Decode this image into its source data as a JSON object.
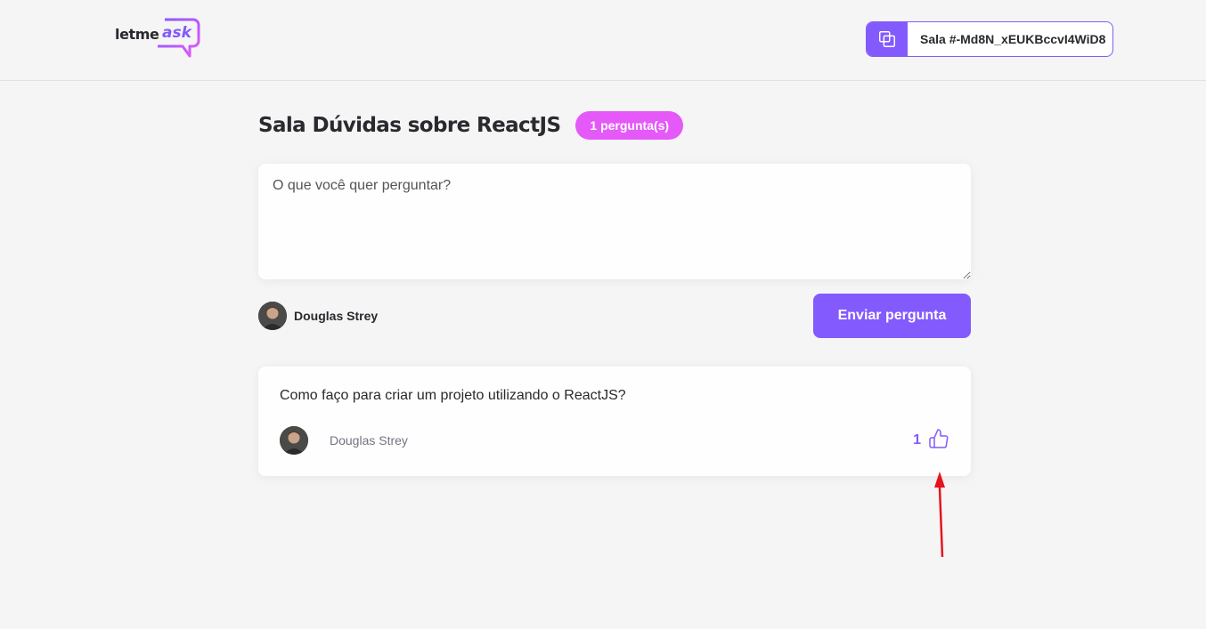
{
  "header": {
    "logo": {
      "prefix": "letme",
      "accent": "ask"
    },
    "room_code": {
      "label": "Sala #-Md8N_xEUKBccvI4WiD8",
      "icon": "copy-icon"
    }
  },
  "room": {
    "title": "Sala Dúvidas sobre ReactJS",
    "question_count_label": "1 pergunta(s)"
  },
  "ask_form": {
    "placeholder": "O que você quer perguntar?",
    "user_name": "Douglas Strey",
    "send_label": "Enviar pergunta"
  },
  "questions": [
    {
      "content": "Como faço para criar um projeto utilizando o ReactJS?",
      "author": "Douglas Strey",
      "like_count": "1",
      "like_icon": "thumbs-up-icon"
    }
  ],
  "colors": {
    "primary": "#835afd",
    "badge": "#e559f9",
    "background": "#f5f5f5",
    "annotation_arrow": "#e5141e"
  }
}
